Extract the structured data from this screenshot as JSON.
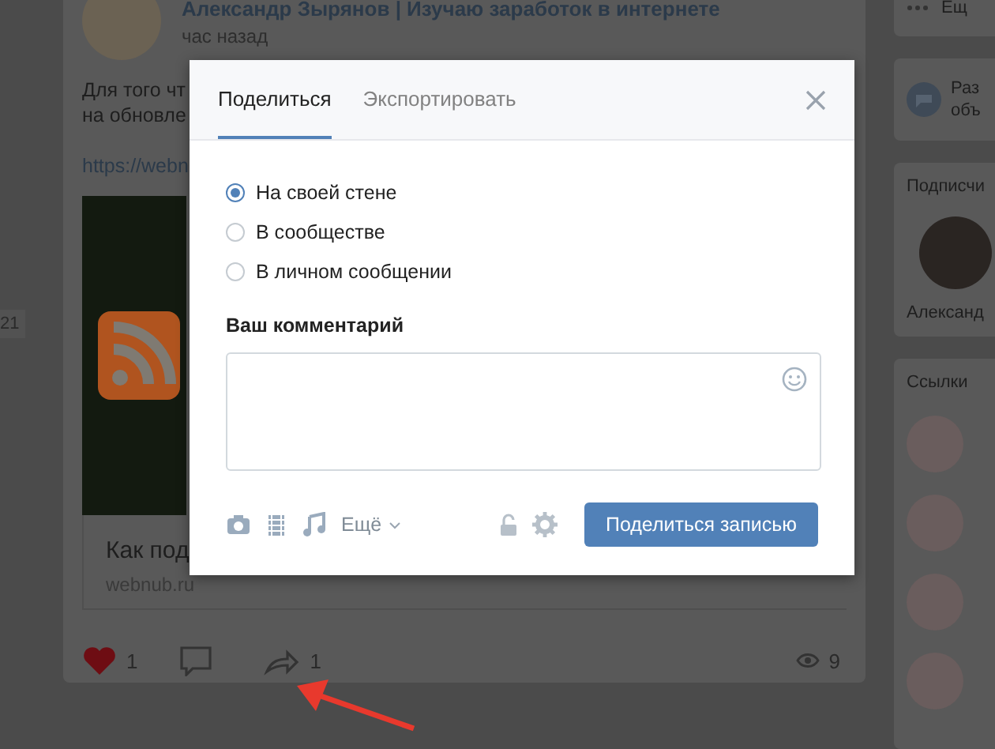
{
  "background": {
    "left_badge": "21",
    "post": {
      "author": "Александр Зырянов | Изучаю заработок в интернете",
      "time": "час назад",
      "text_lines": [
        "Для того чт",
        "на обновле"
      ],
      "link": "https://webn",
      "snippet_title": "Как под",
      "snippet_url": "webnub.ru",
      "likes": "1",
      "liked": true,
      "shares": "1",
      "views": "9"
    },
    "sidebar": {
      "more": "Ещ",
      "notice_lines": [
        "Раз",
        "объ"
      ],
      "followers_title": "Подписчи",
      "follower_name": "Александ",
      "links_title": "Ссылки"
    }
  },
  "dialog": {
    "tabs": [
      {
        "label": "Поделиться",
        "selected": true
      },
      {
        "label": "Экспортировать",
        "selected": false
      }
    ],
    "targets": [
      {
        "label": "На своей стене",
        "selected": true
      },
      {
        "label": "В сообществе",
        "selected": false
      },
      {
        "label": "В личном сообщении",
        "selected": false
      }
    ],
    "comment_label": "Ваш комментарий",
    "more_label": "Ещё",
    "submit": "Поделиться записью"
  }
}
